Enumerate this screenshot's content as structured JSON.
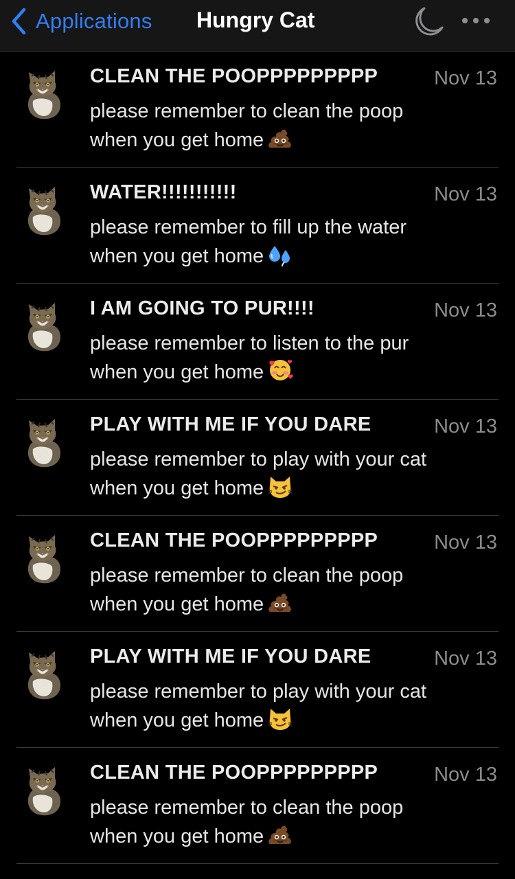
{
  "navbar": {
    "back_label": "Applications",
    "title": "Hungry Cat",
    "accent_color": "#2f7ff5"
  },
  "notifications": [
    {
      "title": "CLEAN THE POOPPPPPPPPP",
      "date": "Nov 13",
      "line1": "please remember to clean the poop",
      "line2": "when you get home",
      "emoji": "poop-emoji"
    },
    {
      "title": "WATER!!!!!!!!!!!",
      "date": "Nov 13",
      "line1": "please remember to fill up the water",
      "line2": "when you get home",
      "emoji": "sweat-droplets-emoji"
    },
    {
      "title": "I AM GOING TO PUR!!!!",
      "date": "Nov 13",
      "line1": "please remember to listen to the pur",
      "line2": "when you get home",
      "emoji": "smiling-face-with-hearts-emoji"
    },
    {
      "title": "PLAY WITH ME IF YOU DARE",
      "date": "Nov 13",
      "line1": "please remember to play with your cat",
      "line2": "when you get home",
      "emoji": "smirk-cat-emoji"
    },
    {
      "title": "CLEAN THE POOPPPPPPPPP",
      "date": "Nov 13",
      "line1": "please remember to clean the poop",
      "line2": "when you get home",
      "emoji": "poop-emoji"
    },
    {
      "title": "PLAY WITH ME IF YOU DARE",
      "date": "Nov 13",
      "line1": "please remember to play with your cat",
      "line2": "when you get home",
      "emoji": "smirk-cat-emoji"
    },
    {
      "title": "CLEAN THE POOPPPPPPPPP",
      "date": "Nov 13",
      "line1": "please remember to clean the poop",
      "line2": "when you get home",
      "emoji": "poop-emoji"
    }
  ]
}
